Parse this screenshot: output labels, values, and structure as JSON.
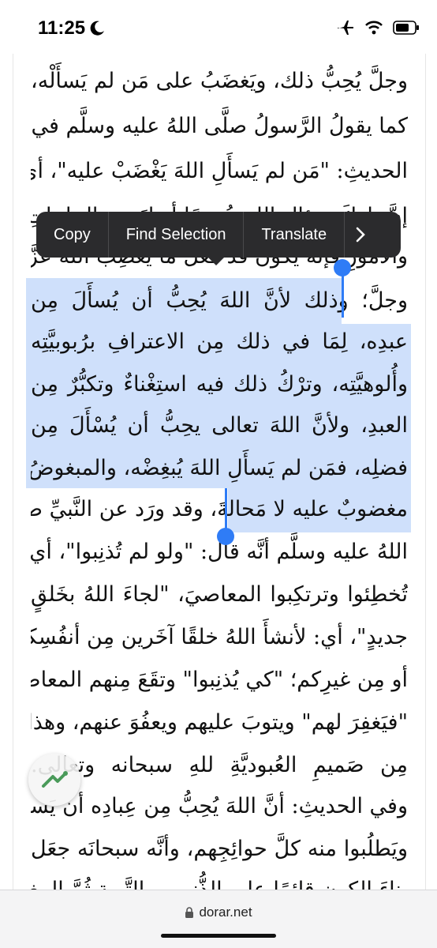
{
  "status_bar": {
    "time": "11:25",
    "icons": [
      "moon-icon",
      "airplane-icon",
      "wifi-icon",
      "battery-icon"
    ]
  },
  "context_menu": {
    "items": [
      "Copy",
      "Find Selection",
      "Translate"
    ],
    "more_icon": "chevron-right-icon"
  },
  "article": {
    "lines": [
      "وجلَّ يُحِبُّ ذلك، ويَغضَبُ على مَن لم يَسأَلْه،",
      "كما يقولُ الرَّسولُ صلَّى اللهُ عليه وسلَّم في هذا",
      "الحديثِ: \"مَن لم يَسأَلِ اللهَ يَغْضَبْ عليه\"، أي:",
      "إنَّ تاركَ سؤالِ اللهِ عُمومًا أو لبَعضِ الحاجاتِ",
      "والأمورِ فإنَّه يكونُ قد فعَل ما يُغضِبُ اللهَ عزَّ",
      "وجلَّ؛ وذلك لأنَّ اللهَ يُحِبُّ أن يُسأَلَ مِن",
      "عبدِه، لِمَا في ذلك مِن الاعترافِ برُبوبيَّتِه",
      "وأُلوهيَّتِه، وترْكُ ذلك فيه استِغْناءٌ وتكبُّرٌ مِن",
      "العبدِ، ولأنَّ اللهَ تعالى يحِبُّ أن يُسْأَلَ مِن",
      "فضلِه، فمَن لم يَسأَلِ اللهَ يُبغِضْه، والمبغوضُ",
      "مغضوبٌ عليه لا مَحالةَ، وقد ورَد عن النَّبيِّ صلَّى",
      "اللهُ عليه وسلَّم أنَّه قال: \"ولو لم تُذنِبوا\"، أي:",
      "تُخطِئوا وترتكِبوا المعاصيَ، \"لجاءَ اللهُ بخَلقٍ",
      "جديدٍ\"، أي: لأنشأَ اللهُ خلقًا آخَرين مِن أنفُسِكم",
      "أو مِن غيرِكم؛ \"كي يُذنِبوا\" وتقَعَ مِنهم المعاصي،",
      "\"فيَغفِرَ لهم\" ويتوبَ عليهم ويعفُوَ عنهم، وهذا",
      "مِن صَميمِ العُبوديَّةِ للهِ سبحانه وتعالى.",
      "وفي الحديثِ: أنَّ اللهَ يُحِبُّ مِن عِبادِه أن يَسأَلوه",
      "ويَطلُبوا منه كلَّ حوائِجِهم، وأنَّه سبحانَه جعَل",
      "بِناءَ الكونِ قائمًا على الذُّنوبِ والتَّوبةِ ثُمَّ المغفرةِ"
    ]
  },
  "fab": {
    "icon": "app-logo-icon"
  },
  "bottom_bar": {
    "url": "dorar.net",
    "lock_icon": "lock-icon"
  },
  "colors": {
    "selection": "#cfe0fb",
    "handle": "#2f7cf6",
    "menu_bg": "#2b2b2d"
  }
}
